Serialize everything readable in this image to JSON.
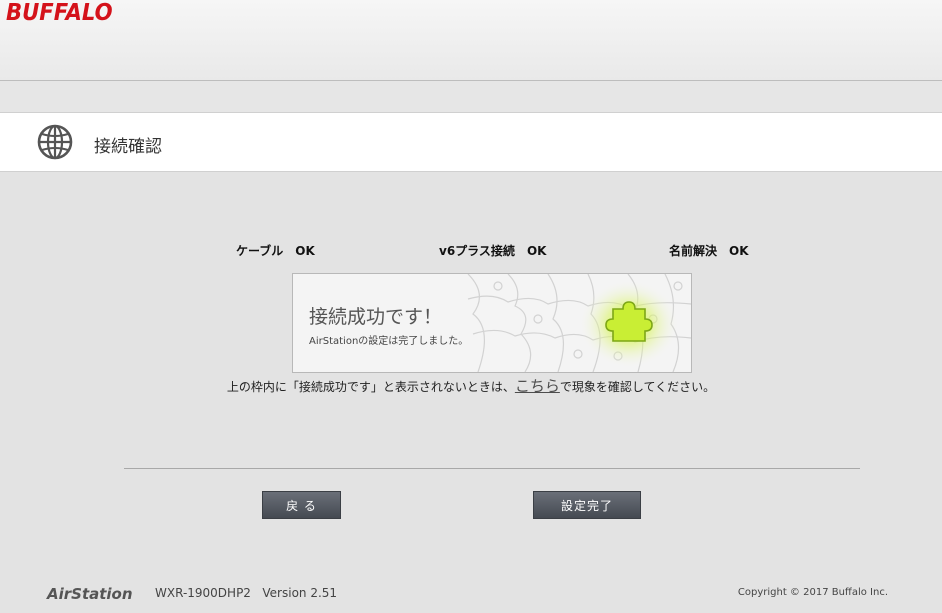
{
  "header": {
    "brand": "BUFFALO",
    "brand_color": "#d4121a"
  },
  "title_bar": {
    "icon": "globe-icon",
    "title": "接続確認"
  },
  "status": [
    {
      "label": "ケーブル",
      "value": "OK"
    },
    {
      "label": "v6プラス接続",
      "value": "OK"
    },
    {
      "label": "名前解決",
      "value": "OK"
    }
  ],
  "result_frame": {
    "title": "接続成功です！",
    "subtitle": "AirStationの設定は完了しました。"
  },
  "note": {
    "before": "上の枠内に「接続成功です」と表示されないときは、",
    "link": "こちら",
    "after": "で現象を確認してください。"
  },
  "buttons": {
    "back": "戻 る",
    "finish": "設定完了"
  },
  "footer": {
    "brand": "AirStation",
    "model": "WXR-1900DHP2   Version 2.51",
    "copyright": "Copyright © 2017 Buffalo Inc."
  }
}
